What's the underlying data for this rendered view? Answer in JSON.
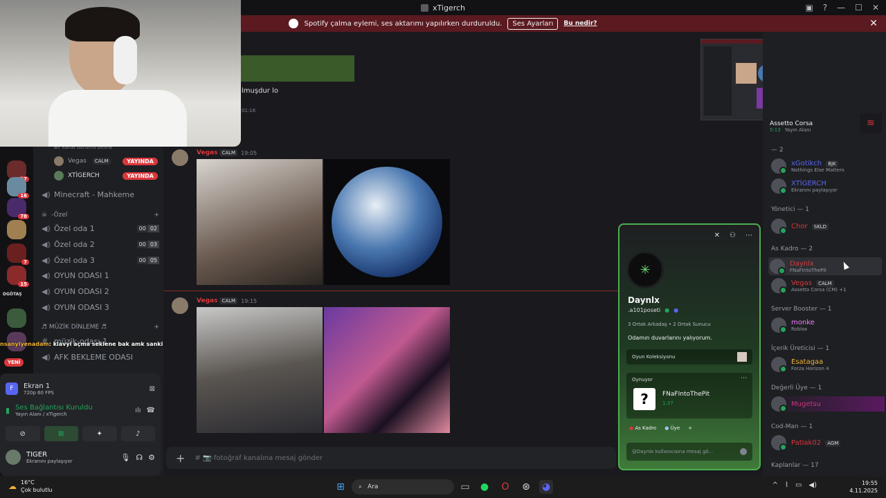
{
  "window": {
    "title": "xTigerch"
  },
  "notice": {
    "text": "Spotify çalma eylemi, ses aktarımı yapılırken durduruldu.",
    "button": "Ses Ayarları",
    "link": "Bu nedir?"
  },
  "rail": {
    "badges": [
      "17",
      "16",
      "78",
      "7",
      "15"
    ],
    "text_label": "DGÖTAŞ",
    "new_label": "YENİ"
  },
  "channels": {
    "status_hint": "Bir kanal durumu belirle",
    "voice_users": [
      {
        "name": "Vegas",
        "tag": "CALM",
        "live": "YAYINDA"
      },
      {
        "name": "XTİGERCH",
        "live": "YAYINDA"
      }
    ],
    "items": [
      {
        "name": "Minecraft - Mahkeme"
      },
      {
        "name": "Özel oda 1",
        "lim": [
          "00",
          "02"
        ]
      },
      {
        "name": "Özel oda 2",
        "lim": [
          "00",
          "03"
        ]
      },
      {
        "name": "Özel oda 3",
        "lim": [
          "00",
          "05"
        ]
      },
      {
        "name": "OYUN ODASI 1"
      },
      {
        "name": "OYUN ODASI 2"
      },
      {
        "name": "OYUN ODASI 3"
      },
      {
        "name": "müzik-odası-1"
      },
      {
        "name": "AFK BEKLEME ODASI"
      }
    ],
    "category_private": "-Özel",
    "category_music": "♬ MÜZİK DİNLEME ♬"
  },
  "overlay_chat": {
    "user": "nsanyiyenadam",
    "text": ": klavyi açma seklene bak amk sanki içinde yapay am arıyor gibi açı"
  },
  "stream_panel": {
    "title": "Ekran 1",
    "quality": "720p 60 FPS"
  },
  "voice_panel": {
    "status": "Ses Bağlantısı Kuruldu",
    "sub": "Yayın Alanı",
    "server": "/ xTigerch"
  },
  "user_panel": {
    "name": "TIGER",
    "status": "Ekranını paylaşıyor"
  },
  "chat": {
    "partial_text": "lmuşdur lo",
    "partial_time": "01:16",
    "messages": [
      {
        "author": "Vegas",
        "tag": "CALM",
        "time": "19:05"
      },
      {
        "author": "Vegas",
        "tag": "CALM",
        "time": "19:15"
      }
    ],
    "input_placeholder": "# 📷-fotoğraf kanalına mesaj gönder"
  },
  "members": {
    "top_game": {
      "name": "Assetto Corsa",
      "time": "5:13",
      "voice": "Yayın Alanı"
    },
    "groups": [
      {
        "head": "— 2",
        "members": [
          {
            "name": "xGotikch",
            "tag": "BJK",
            "sub": "Nothings Else Matters",
            "color": "#5865f2"
          },
          {
            "name": "XTİGERCH",
            "sub": "Ekranını paylaşıyor",
            "color": "#5865f2"
          }
        ]
      },
      {
        "head": "Yönetici — 1",
        "members": [
          {
            "name": "Chor",
            "tag": "SKLD",
            "sub": "",
            "color": "#da373c"
          }
        ]
      },
      {
        "head": "As Kadro — 2",
        "members": [
          {
            "name": "Daynlx",
            "sub": "FNaFIntoThePit",
            "color": "#da373c"
          },
          {
            "name": "Vegas",
            "tag": "CALM",
            "sub": "Assetto Corsa (CM) +1",
            "color": "#da373c"
          }
        ]
      },
      {
        "head": "Server Booster — 1",
        "members": [
          {
            "name": "monke",
            "sub": "Roblox",
            "color": "#f47fff"
          }
        ]
      },
      {
        "head": "İçerik Üreticisi — 1",
        "members": [
          {
            "name": "Esatagaa",
            "sub": "Forza Horizon 4",
            "color": "#f0b232"
          }
        ]
      },
      {
        "head": "Değerli Üye — 1",
        "members": [
          {
            "name": "Mugetsu",
            "sub": "",
            "color": "#c43a7a"
          }
        ]
      },
      {
        "head": "Cod-Man — 1",
        "members": [
          {
            "name": "Patlak02",
            "tag": "AGM",
            "sub": "",
            "color": "#da373c"
          }
        ]
      }
    ],
    "last_head": "Kaplanlar — 17"
  },
  "popout": {
    "name": "Daynlx",
    "handle": ".a101poseti",
    "mutual": "3 Ortak Arkadaş • 2 Ortak Sunucu",
    "bio": "Odamın duvarlarını yalıyorum.",
    "collection": "Oyun Koleksiyonu",
    "playing_label": "Oynuyor",
    "game": "FNaFIntoThePit",
    "game_time": "1:37",
    "roles": [
      "As Kadro",
      "Üye"
    ],
    "message_placeholder": "@Daynlx kullanıcısına mesaj gö..."
  },
  "taskbar": {
    "weather_temp": "16°C",
    "weather_desc": "Çok bulutlu",
    "search": "Ara",
    "time": "19:55",
    "date": "4.11.2025"
  }
}
